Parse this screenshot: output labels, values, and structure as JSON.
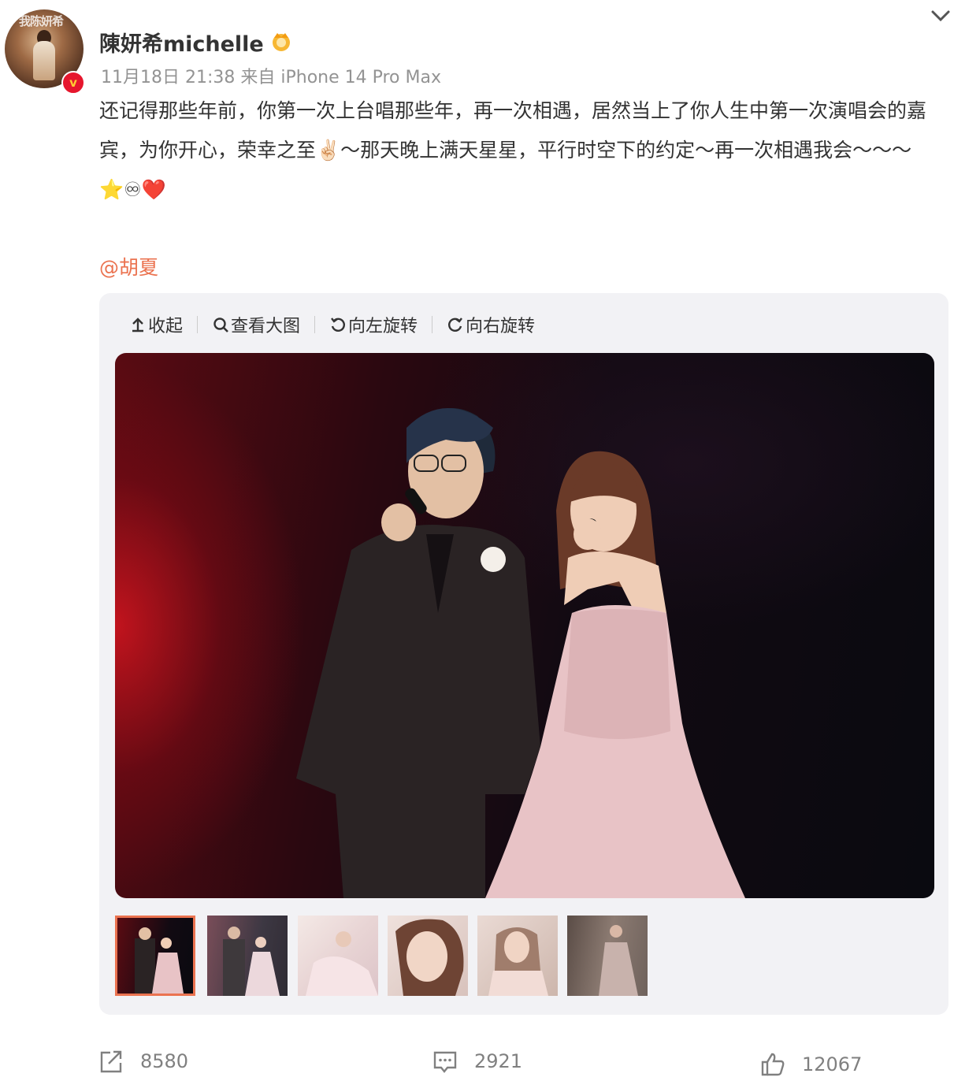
{
  "post": {
    "username": "陳妍希michelle",
    "meta": "11月18日 21:38  来自 iPhone 14 Pro Max",
    "text": "还记得那些年前，你第一次上台唱那些年，再一次相遇，居然当上了你人生中第一次演唱会的嘉宾，为你开心，荣幸之至✌🏻～那天晚上满天星星，平行时空下的约定～再一次相遇我会～～～⭐♾❤️",
    "mention": "@胡夏",
    "avatar_sign": "我陈妍希"
  },
  "toolbar": {
    "collapse": "收起",
    "view_large": "查看大图",
    "rotate_left": "向左旋转",
    "rotate_right": "向右旋转"
  },
  "stats": {
    "repost": "8580",
    "comment": "2921",
    "like": "12067"
  },
  "thumbnails": [
    {
      "name": "thumb-1",
      "active": true
    },
    {
      "name": "thumb-2",
      "active": false
    },
    {
      "name": "thumb-3",
      "active": false
    },
    {
      "name": "thumb-4",
      "active": false
    },
    {
      "name": "thumb-5",
      "active": false
    },
    {
      "name": "thumb-6",
      "active": false
    }
  ],
  "colors": {
    "accent": "#eb7350",
    "verified": "#e6162d",
    "panel": "#f2f2f5"
  }
}
